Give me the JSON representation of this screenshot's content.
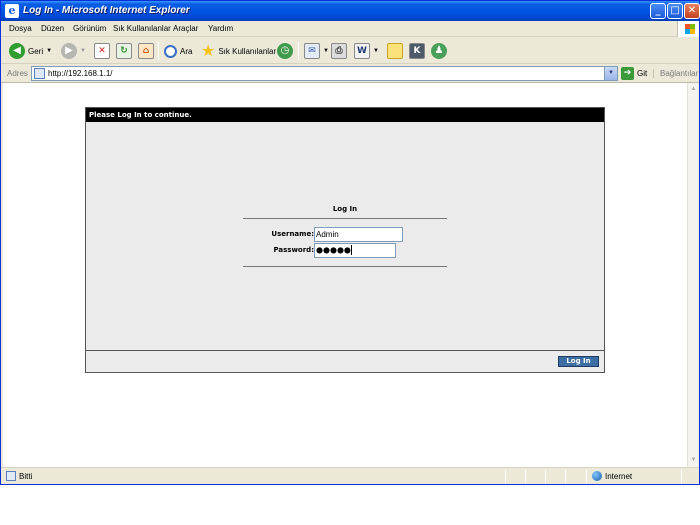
{
  "window": {
    "title": "Log In - Microsoft Internet Explorer",
    "minimize": "_",
    "maximize": "□",
    "close": "✕"
  },
  "menu": {
    "items": [
      "Dosya",
      "Düzen",
      "Görünüm",
      "Sık Kullanılanlar",
      "Araçlar",
      "Yardım"
    ]
  },
  "toolbar": {
    "back_label": "Geri",
    "search_label": "Ara",
    "favorites_label": "Sık Kullanılanlar"
  },
  "address": {
    "label": "Adres",
    "url": "http://192.168.1.1/",
    "go_label": "Git",
    "links_label": "Bağlantılar"
  },
  "page": {
    "header": "Please Log In to continue.",
    "login_title": "Log In",
    "username_label": "Username:",
    "username_value": "Admin",
    "password_label": "Password:",
    "password_masked": "●●●●●",
    "login_button": "Log In"
  },
  "status": {
    "text": "Bitti",
    "zone": "Internet"
  },
  "colors": {
    "titlebar": "#0054e3",
    "login_button": "#3d6fa5",
    "panel_bg": "#ebebeb",
    "header_bg": "#000000"
  },
  "icons": [
    "ie-icon",
    "back-icon",
    "forward-icon",
    "stop-icon",
    "refresh-icon",
    "home-icon",
    "search-icon",
    "favorites-icon",
    "history-icon",
    "mail-icon",
    "print-icon",
    "word-icon",
    "notes-icon",
    "k-icon",
    "messenger-icon",
    "go-icon",
    "globe-icon"
  ]
}
